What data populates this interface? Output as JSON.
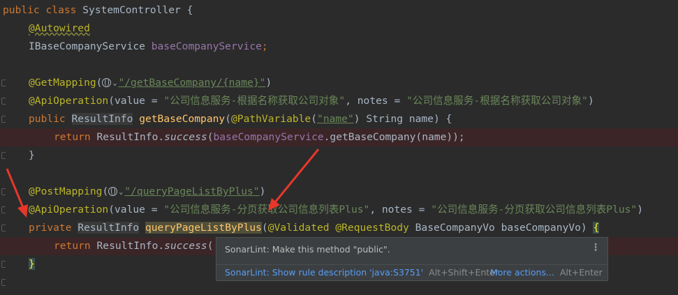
{
  "code": {
    "l1": {
      "kw_public": "public",
      "kw_class": "class",
      "class_name": "SystemController",
      "brace": "{"
    },
    "l2": {
      "annotation": "@Autowired"
    },
    "l3": {
      "type": "IBaseCompanyService",
      "field": "baseCompanyService",
      "semi": ";"
    },
    "l5": {
      "annotation": "@GetMapping",
      "open": "(",
      "path": "\"/getBaseCompany/{name}\"",
      "close": ")"
    },
    "l6": {
      "annotation": "@ApiOperation",
      "p1": "(value = ",
      "value": "\"公司信息服务-根据名称获取公司对象\"",
      "p2": ", notes = ",
      "notes": "\"公司信息服务-根据名称获取公司对象\"",
      "p3": ")"
    },
    "l7": {
      "kw": "public",
      "ret": "ResultInfo",
      "method": "getBaseCompany",
      "p1": "(",
      "ann": "@PathVariable",
      "p2": "(",
      "str": "\"name\"",
      "p3": ") String name) {"
    },
    "l8": {
      "kw": "return",
      "cls": "ResultInfo.",
      "method": "success",
      "p1": "(",
      "field": "baseCompanyService",
      "p2": ".getBaseCompany(name));"
    },
    "l9": {
      "brace": "}"
    },
    "l11": {
      "annotation": "@PostMapping",
      "open": "(",
      "path": "\"/queryPageListByPlus\"",
      "close": ")"
    },
    "l12": {
      "annotation": "@ApiOperation",
      "p1": "(value = ",
      "value": "\"公司信息服务-分页获取公司信息列表Plus\"",
      "p2": ", notes = ",
      "notes": "\"公司信息服务-分页获取公司信息列表Plus\"",
      "p3": ")"
    },
    "l13": {
      "kw": "private",
      "ret": "ResultInfo",
      "method": "queryPageListByPlus",
      "p1": "(",
      "ann1": "@Validated",
      "ann2": "@RequestBody",
      "p2": "BaseCompanyVo baseCompanyVo) ",
      "brace": "{"
    },
    "l14": {
      "kw": "return",
      "cls": "ResultInfo.",
      "method": "success",
      "p1": "("
    },
    "l15": {
      "brace": "}"
    }
  },
  "popup": {
    "message": "SonarLint: Make this method \"public\".",
    "menu_icon": "⋮",
    "show_rule": "SonarLint: Show rule description 'java:S3751'",
    "show_rule_shortcut": "Alt+Shift+Enter",
    "more_actions": "More actions...",
    "more_actions_shortcut": "Alt+Enter"
  },
  "colors": {
    "background": "#2b2b2b",
    "error_line": "#3b2526",
    "arrow": "#e8372a"
  }
}
